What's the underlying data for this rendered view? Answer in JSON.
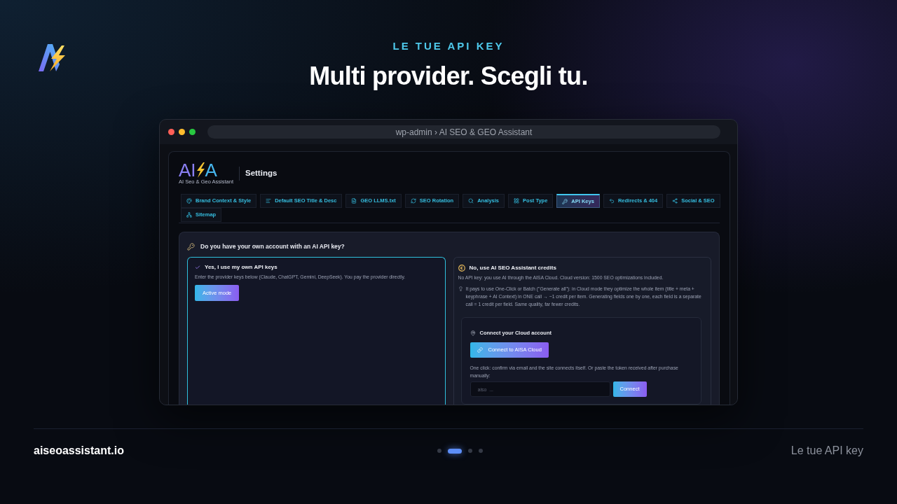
{
  "header": {
    "eyebrow": "LE TUE API KEY",
    "title": "Multi provider. Scegli tu."
  },
  "browser": {
    "address": "wp-admin › AI SEO & GEO Assistant"
  },
  "app": {
    "logo": {
      "left": "AI",
      "right": "A",
      "tagline": "AI Seo & Geo Assistant"
    },
    "page_title": "Settings",
    "tabs": [
      {
        "label": "Brand Context & Style",
        "selected": false
      },
      {
        "label": "Default SEO Title & Desc",
        "selected": false
      },
      {
        "label": "GEO LLMS.txt",
        "selected": false
      },
      {
        "label": "SEO Rotation",
        "selected": false
      },
      {
        "label": "Analysis",
        "selected": false
      },
      {
        "label": "Post Type",
        "selected": false
      },
      {
        "label": "API Keys",
        "selected": true
      },
      {
        "label": "Redirects & 404",
        "selected": false
      },
      {
        "label": "Social & SEO",
        "selected": false
      },
      {
        "label": "Sitemap",
        "selected": false
      }
    ],
    "question": "Do you have your own account with an AI API key?",
    "options": [
      {
        "selected": true,
        "title": "Yes, I use my own API keys",
        "description": "Enter the provider keys below (Claude, ChatGPT, Gemini, DeepSeek). You pay the provider directly.",
        "button": "Active mode"
      },
      {
        "selected": false,
        "title": "No, use AI SEO Assistant credits",
        "description": "No API key: you use AI through the AISA Cloud. Cloud version: 1500 SEO optimizations included.",
        "tip": "It pays to use One-Click or Batch (\"Generate all\"): in Cloud mode they optimize the whole item (title + meta + keyphrase + AI Context) in ONE call → ~1 credit per item. Generating fields one by one, each field is a separate call = 1 credit per field. Same quality, far fewer credits.",
        "cloud": {
          "title": "Connect your Cloud account",
          "button": "Connect to AISA Cloud",
          "hint": "One click: confirm via email and the site connects itself. Or paste the token received after purchase manually:",
          "placeholder": "aiso_...",
          "connect_button": "Connect"
        }
      }
    ]
  },
  "footer": {
    "site": "aiseoassistant.io",
    "pages": [
      {
        "selected": false
      },
      {
        "selected": true
      },
      {
        "selected": false
      },
      {
        "selected": false
      }
    ],
    "caption": "Le tue API key"
  }
}
